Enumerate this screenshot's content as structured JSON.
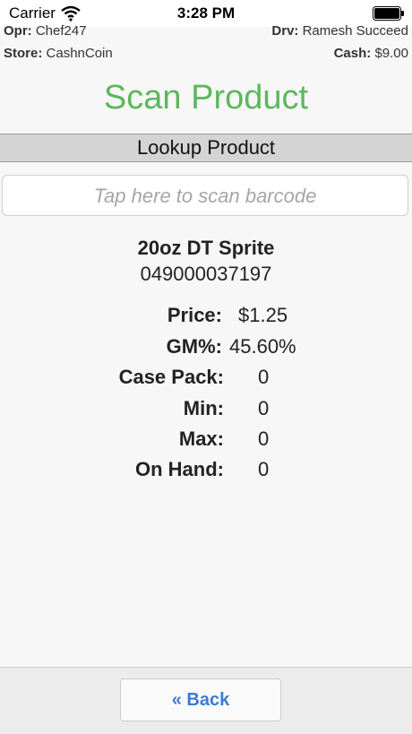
{
  "status_bar": {
    "carrier": "Carrier",
    "time": "3:28 PM"
  },
  "header": {
    "opr_label": "Opr:",
    "opr_value": "Chef247",
    "drv_label": "Drv:",
    "drv_value": "Ramesh Succeed",
    "store_label": "Store:",
    "store_value": "CashnCoin",
    "cash_label": "Cash:",
    "cash_value": "$9.00"
  },
  "page_title": "Scan Product",
  "section_title": "Lookup Product",
  "scan_input": {
    "placeholder": "Tap here to scan barcode"
  },
  "product": {
    "name": "20oz DT Sprite",
    "upc": "049000037197"
  },
  "details": [
    {
      "label": "Price:",
      "value": "$1.25"
    },
    {
      "label": "GM%:",
      "value": "45.60%"
    },
    {
      "label": "Case Pack:",
      "value": "0"
    },
    {
      "label": "Min:",
      "value": "0"
    },
    {
      "label": "Max:",
      "value": "0"
    },
    {
      "label": "On Hand:",
      "value": "0"
    }
  ],
  "back_button": {
    "label": "« Back"
  },
  "colors": {
    "title_green": "#5cb85c",
    "link_blue": "#3a7bd5"
  }
}
